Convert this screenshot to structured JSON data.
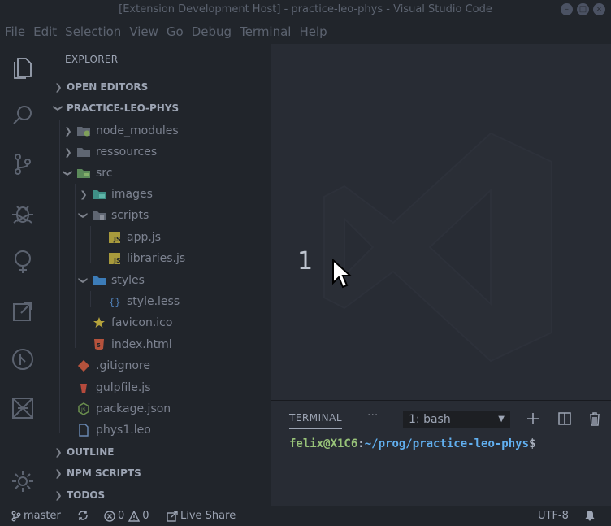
{
  "window": {
    "title": "[Extension Development Host] - practice-leo-phys - Visual Studio Code"
  },
  "menu": [
    "File",
    "Edit",
    "Selection",
    "View",
    "Go",
    "Debug",
    "Terminal",
    "Help"
  ],
  "activity_icons": [
    "files-icon",
    "search-icon",
    "source-control-icon",
    "debug-icon",
    "leo-tree-icon",
    "remote-explorer-icon",
    "git-graph-icon",
    "live-share-icon",
    "settings-gear-icon"
  ],
  "sidebar": {
    "title": "EXPLORER",
    "sections": {
      "open_editors": "OPEN EDITORS",
      "project": "PRACTICE-LEO-PHYS",
      "outline": "OUTLINE",
      "npm_scripts": "NPM SCRIPTS",
      "todos": "TODOS"
    },
    "tree": [
      {
        "label": "node_modules",
        "indent": 0,
        "chevron": "right",
        "icon": "folder-node-icon"
      },
      {
        "label": "ressources",
        "indent": 0,
        "chevron": "right",
        "icon": "folder-icon"
      },
      {
        "label": "src",
        "indent": 0,
        "chevron": "down",
        "icon": "folder-src-icon"
      },
      {
        "label": "images",
        "indent": 1,
        "chevron": "right",
        "icon": "folder-images-icon"
      },
      {
        "label": "scripts",
        "indent": 1,
        "chevron": "down",
        "icon": "folder-scripts-icon"
      },
      {
        "label": "app.js",
        "indent": 2,
        "chevron": "none",
        "icon": "js-file-icon"
      },
      {
        "label": "libraries.js",
        "indent": 2,
        "chevron": "none",
        "icon": "js-file-icon"
      },
      {
        "label": "styles",
        "indent": 1,
        "chevron": "down",
        "icon": "folder-styles-icon"
      },
      {
        "label": "style.less",
        "indent": 2,
        "chevron": "none",
        "icon": "less-file-icon"
      },
      {
        "label": "favicon.ico",
        "indent": 1,
        "chevron": "none",
        "icon": "favicon-star-icon"
      },
      {
        "label": "index.html",
        "indent": 1,
        "chevron": "none",
        "icon": "html-file-icon"
      },
      {
        "label": ".gitignore",
        "indent": 0,
        "chevron": "none",
        "icon": "git-file-icon"
      },
      {
        "label": "gulpfile.js",
        "indent": 0,
        "chevron": "none",
        "icon": "gulp-file-icon"
      },
      {
        "label": "package.json",
        "indent": 0,
        "chevron": "none",
        "icon": "node-package-icon"
      },
      {
        "label": "phys1.leo",
        "indent": 0,
        "chevron": "none",
        "icon": "generic-file-icon"
      }
    ]
  },
  "editor": {
    "overlay_number": "1"
  },
  "panel": {
    "tab_label": "TERMINAL",
    "more_label": "···",
    "selected_terminal": "1: bash",
    "prompt_user": "felix@X1C6",
    "prompt_sep": ":",
    "prompt_path": "~/prog/practice-leo-phys",
    "prompt_symbol": "$"
  },
  "status": {
    "branch": "master",
    "errors": "0",
    "warnings": "0",
    "live_share": "Live Share",
    "encoding": "UTF-8"
  },
  "colors": {
    "background": "#282c34",
    "sidebar": "#21252b",
    "prompt_user": "#98c379",
    "prompt_path": "#61afef"
  }
}
